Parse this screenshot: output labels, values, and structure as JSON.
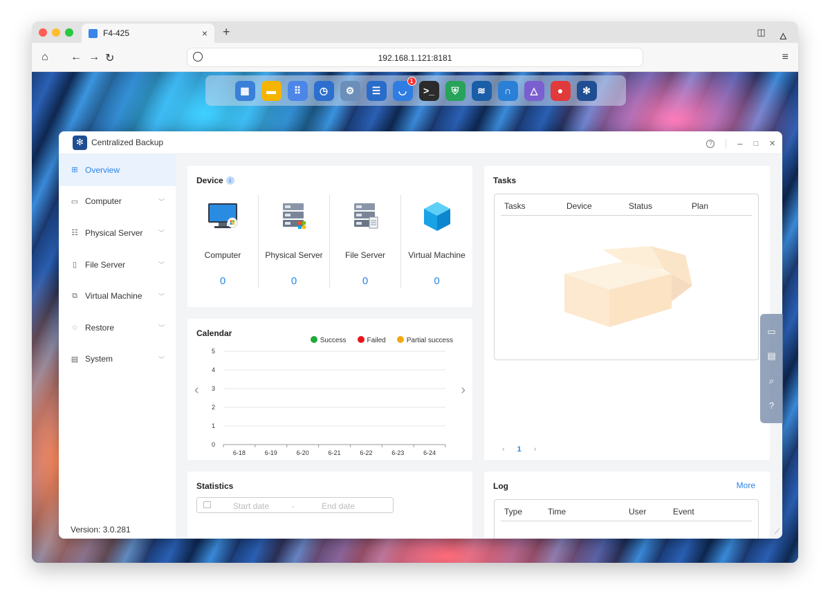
{
  "browser": {
    "tab_title": "F4-425",
    "tab_close": "×",
    "new_tab": "+",
    "url": "192.168.1.121:8181"
  },
  "dock": {
    "apps": [
      {
        "name": "file-manager-icon",
        "color": "#3a7fd8",
        "glyph": "▦"
      },
      {
        "name": "notes-icon",
        "color": "#f4b400",
        "glyph": "▬"
      },
      {
        "name": "app-center-icon",
        "color": "#4c86e8",
        "glyph": "⠿"
      },
      {
        "name": "backup-clock-icon",
        "color": "#2c6fcf",
        "glyph": "◷"
      },
      {
        "name": "settings-gear-icon",
        "color": "#6b8fb8",
        "glyph": "⚙"
      },
      {
        "name": "storage-icon",
        "color": "#2a6cc9",
        "glyph": "☰"
      },
      {
        "name": "shopping-bag-icon",
        "color": "#2f7de3",
        "glyph": "◡",
        "badge": "1"
      },
      {
        "name": "terminal-icon",
        "color": "#2b2b2b",
        "glyph": ">_"
      },
      {
        "name": "security-shield-icon",
        "color": "#27a35a",
        "glyph": "⛨"
      },
      {
        "name": "docker-whale-icon",
        "color": "#1a5ea8",
        "glyph": "≋"
      },
      {
        "name": "headset-support-icon",
        "color": "#2a7fd6",
        "glyph": "∩"
      },
      {
        "name": "jellyfin-icon",
        "color": "#7b5fd0",
        "glyph": "△"
      },
      {
        "name": "beta-bird-icon",
        "color": "#e03a3a",
        "glyph": "●"
      },
      {
        "name": "centralized-backup-icon",
        "color": "#1f4f92",
        "glyph": "✻"
      }
    ]
  },
  "window": {
    "title": "Centralized Backup",
    "help": "?",
    "minimize": "–",
    "maximize": "□",
    "close": "×"
  },
  "sidebar": {
    "items": [
      {
        "label": "Overview",
        "icon": "grid-icon",
        "glyph": "⊞",
        "active": true
      },
      {
        "label": "Computer",
        "icon": "monitor-icon",
        "glyph": "▭"
      },
      {
        "label": "Physical Server",
        "icon": "server-icon",
        "glyph": "☷"
      },
      {
        "label": "File Server",
        "icon": "file-server-icon",
        "glyph": "▯"
      },
      {
        "label": "Virtual Machine",
        "icon": "virtual-machine-icon",
        "glyph": "⧉"
      },
      {
        "label": "Restore",
        "icon": "restore-icon",
        "glyph": "◌"
      },
      {
        "label": "System",
        "icon": "system-icon",
        "glyph": "▤"
      }
    ],
    "chevron": "﹀",
    "version": "Version: 3.0.281"
  },
  "device": {
    "title": "Device",
    "info": "i",
    "items": [
      {
        "label": "Computer",
        "count": "0"
      },
      {
        "label": "Physical Server",
        "count": "0"
      },
      {
        "label": "File Server",
        "count": "0"
      },
      {
        "label": "Virtual Machine",
        "count": "0"
      }
    ]
  },
  "calendar": {
    "title": "Calendar",
    "prev": "‹",
    "next": "›"
  },
  "chart_data": {
    "type": "bar",
    "categories": [
      "6-18",
      "6-19",
      "6-20",
      "6-21",
      "6-22",
      "6-23",
      "6-24"
    ],
    "series": [
      {
        "name": "Success",
        "color": "#22a93a",
        "values": [
          0,
          0,
          0,
          0,
          0,
          0,
          0
        ]
      },
      {
        "name": "Failed",
        "color": "#e8141c",
        "values": [
          0,
          0,
          0,
          0,
          0,
          0,
          0
        ]
      },
      {
        "name": "Partial success",
        "color": "#f4a712",
        "values": [
          0,
          0,
          0,
          0,
          0,
          0,
          0
        ]
      }
    ],
    "ylim": [
      0,
      5
    ],
    "yticks": [
      "0",
      "1",
      "2",
      "3",
      "4",
      "5"
    ],
    "grid": true,
    "legend": "top-right"
  },
  "tasks": {
    "title": "Tasks",
    "columns": [
      "Tasks",
      "Device",
      "Status",
      "Plan"
    ],
    "pager_prev": "‹",
    "pager_current": "1",
    "pager_next": "›"
  },
  "statistics": {
    "title": "Statistics",
    "start_placeholder": "Start date",
    "separator": "-",
    "end_placeholder": "End date"
  },
  "log": {
    "title": "Log",
    "more": "More",
    "columns": [
      "Type",
      "Time",
      "User",
      "Event"
    ]
  },
  "float_bar": {
    "items": [
      "chart-icon",
      "message-icon",
      "search-icon",
      "help-icon"
    ]
  }
}
